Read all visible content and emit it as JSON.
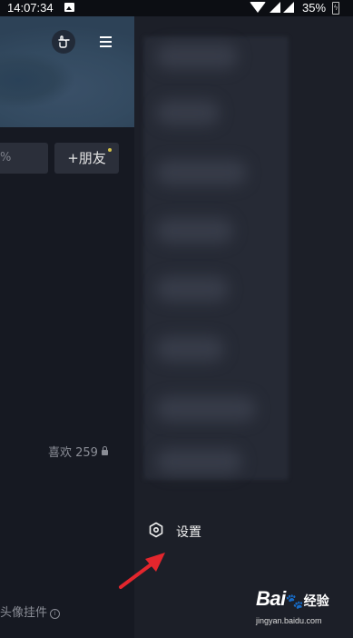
{
  "status_bar": {
    "time": "14:07:34",
    "battery": "35%"
  },
  "profile": {
    "field_text": "%",
    "add_friend_label": "+朋友",
    "likes_label": "喜欢 259",
    "avatar_widget_label": "头像挂件"
  },
  "drawer": {
    "settings_label": "设置"
  },
  "watermark": {
    "brand": "Bai",
    "brand_suffix": "经验",
    "url": "jingyan.baidu.com"
  },
  "colors": {
    "background": "#1c1f28",
    "arrow": "#e3262d"
  }
}
